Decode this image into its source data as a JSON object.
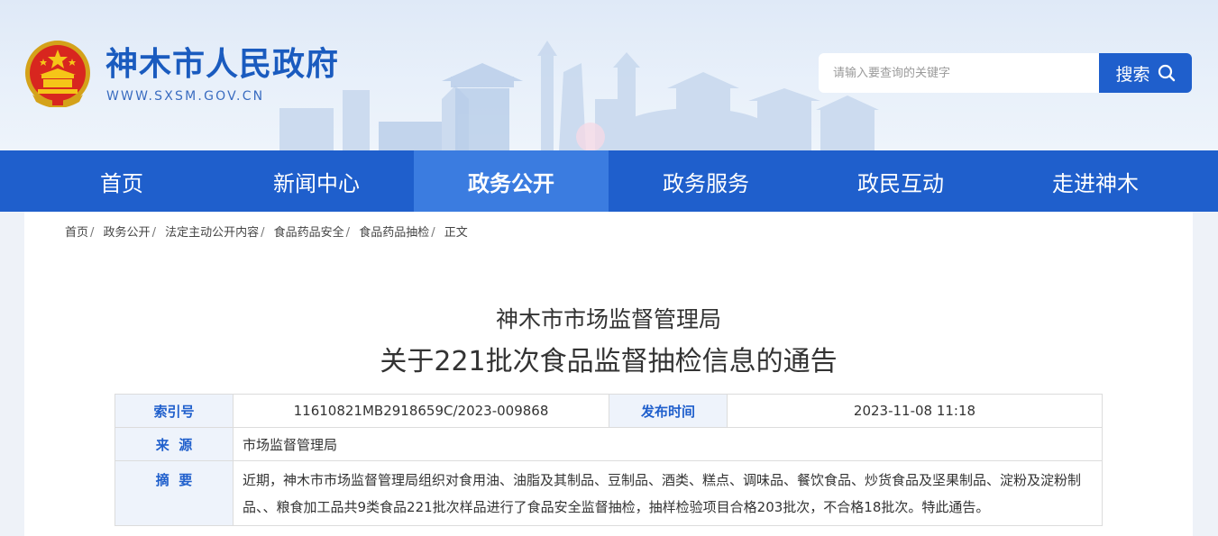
{
  "site": {
    "title": "神木市人民政府",
    "url": "WWW.SXSM.GOV.CN"
  },
  "search": {
    "placeholder": "请输入要查询的关键字",
    "button_label": "搜索"
  },
  "nav": {
    "items": [
      {
        "label": "首页",
        "active": false
      },
      {
        "label": "新闻中心",
        "active": false
      },
      {
        "label": "政务公开",
        "active": true
      },
      {
        "label": "政务服务",
        "active": false
      },
      {
        "label": "政民互动",
        "active": false
      },
      {
        "label": "走进神木",
        "active": false
      }
    ]
  },
  "breadcrumb": {
    "items": [
      "首页",
      "政务公开",
      "法定主动公开内容",
      "食品药品安全",
      "食品药品抽检"
    ],
    "current": "正文",
    "separator": "/"
  },
  "article": {
    "subtitle": "神木市市场监督管理局",
    "title": "关于221批次食品监督抽检信息的通告"
  },
  "meta": {
    "index_label": "索引号",
    "index_value": "11610821MB2918659C/2023-009868",
    "date_label": "发布时间",
    "date_value": "2023-11-08 11:18",
    "source_label": "来  源",
    "source_value": "市场监督管理局",
    "abstract_label": "摘  要",
    "abstract_value": "近期，神木市市场监督管理局组织对食用油、油脂及其制品、豆制品、酒类、糕点、调味品、餐饮食品、炒货食品及坚果制品、淀粉及淀粉制品、、粮食加工品共9类食品221批次样品进行了食品安全监督抽检，抽样检验项目合格203批次，不合格18批次。特此通告。"
  },
  "colors": {
    "brand_blue": "#1f5fcc",
    "nav_active": "#3b7ce0",
    "label_bg": "#eef3fb"
  }
}
